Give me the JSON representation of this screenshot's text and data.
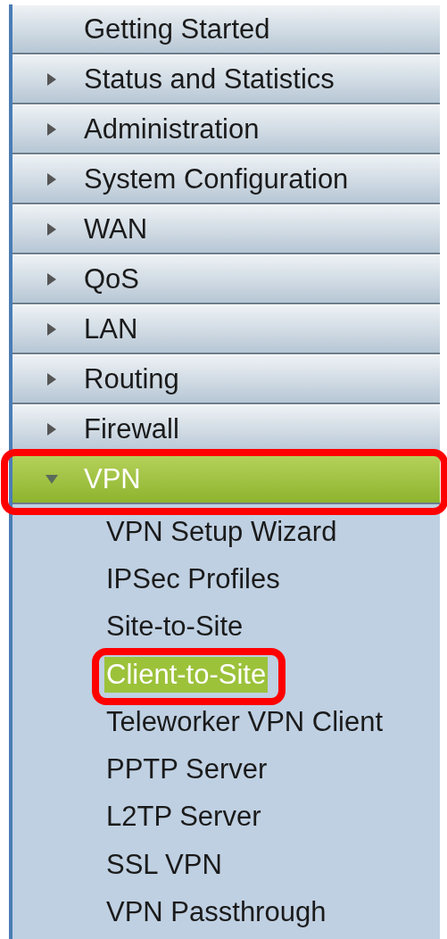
{
  "menu": {
    "items": [
      {
        "kind": "link",
        "label": "Getting Started",
        "expanded": false,
        "selected": false,
        "annotated": false
      },
      {
        "kind": "section",
        "label": "Status and Statistics",
        "expanded": false,
        "selected": false,
        "annotated": false
      },
      {
        "kind": "section",
        "label": "Administration",
        "expanded": false,
        "selected": false,
        "annotated": false
      },
      {
        "kind": "section",
        "label": "System Configuration",
        "expanded": false,
        "selected": false,
        "annotated": false
      },
      {
        "kind": "section",
        "label": "WAN",
        "expanded": false,
        "selected": false,
        "annotated": false
      },
      {
        "kind": "section",
        "label": "QoS",
        "expanded": false,
        "selected": false,
        "annotated": false
      },
      {
        "kind": "section",
        "label": "LAN",
        "expanded": false,
        "selected": false,
        "annotated": false
      },
      {
        "kind": "section",
        "label": "Routing",
        "expanded": false,
        "selected": false,
        "annotated": false
      },
      {
        "kind": "section",
        "label": "Firewall",
        "expanded": false,
        "selected": false,
        "annotated": false
      },
      {
        "kind": "section",
        "label": "VPN",
        "expanded": true,
        "selected": true,
        "annotated": true,
        "children": [
          {
            "label": "VPN Setup Wizard",
            "selected": false,
            "annotated": false
          },
          {
            "label": "IPSec Profiles",
            "selected": false,
            "annotated": false
          },
          {
            "label": "Site-to-Site",
            "selected": false,
            "annotated": false
          },
          {
            "label": "Client-to-Site",
            "selected": true,
            "annotated": true
          },
          {
            "label": "Teleworker VPN Client",
            "selected": false,
            "annotated": false
          },
          {
            "label": "PPTP Server",
            "selected": false,
            "annotated": false
          },
          {
            "label": "L2TP Server",
            "selected": false,
            "annotated": false
          },
          {
            "label": "SSL VPN",
            "selected": false,
            "annotated": false
          },
          {
            "label": "VPN Passthrough",
            "selected": false,
            "annotated": false
          }
        ]
      }
    ]
  }
}
